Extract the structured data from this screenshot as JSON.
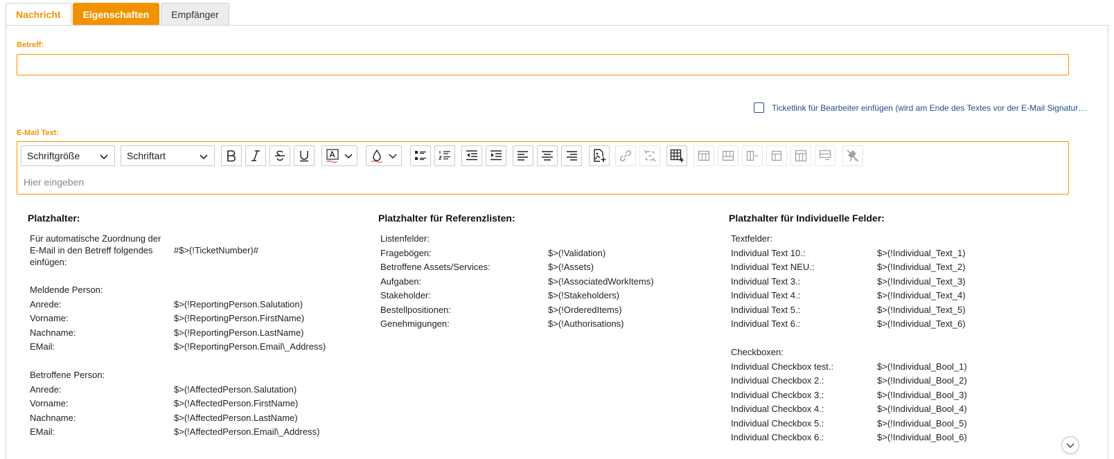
{
  "tabs": [
    {
      "label": "Nachricht"
    },
    {
      "label": "Eigenschaften"
    },
    {
      "label": "Empfänger"
    }
  ],
  "subject": {
    "label": "Betreff:",
    "value": ""
  },
  "ticketlink": {
    "label": "Ticketlink für Bearbeiter einfügen (wird am Ende des Textes vor der E-Mail Signatur eingefügt)",
    "checked": false
  },
  "email_text": {
    "label": "E-Mail Text:",
    "font_size_select": "Schriftgröße",
    "font_family_select": "Schriftart",
    "placeholder": "Hier eingeben"
  },
  "icons": {
    "bold": "bold-icon",
    "italic": "italic-icon",
    "strike": "strikethrough-icon",
    "underline": "underline-icon",
    "font_color": "font-color-icon",
    "highlight": "highlight-color-icon",
    "bullets": "bulleted-list-icon",
    "numbers": "numbered-list-icon",
    "outdent": "outdent-icon",
    "indent": "indent-icon",
    "align_left": "align-left-icon",
    "align_center": "align-center-icon",
    "align_right": "align-right-icon",
    "insert_image": "insert-image-icon",
    "link": "link-icon",
    "unlink": "unlink-icon",
    "table": "insert-table-icon",
    "clear": "clear-format-icon"
  },
  "platzhalter": {
    "title": "Platzhalter:",
    "intro": [
      "Für automatische Zuordnung der",
      "E-Mail in den Betreff folgendes",
      "einfügen:"
    ],
    "intro_value": "#$>(!TicketNumber)#",
    "reporting": {
      "title": "Meldende Person:",
      "rows": [
        {
          "k": "Anrede:",
          "v": "$>(!ReportingPerson.Salutation)"
        },
        {
          "k": "Vorname:",
          "v": "$>(!ReportingPerson.FirstName)"
        },
        {
          "k": "Nachname:",
          "v": "$>(!ReportingPerson.LastName)"
        },
        {
          "k": "EMail:",
          "v": "$>(!ReportingPerson.Email\\_Address)"
        }
      ]
    },
    "affected": {
      "title": "Betroffene Person:",
      "rows": [
        {
          "k": "Anrede:",
          "v": "$>(!AffectedPerson.Salutation)"
        },
        {
          "k": "Vorname:",
          "v": "$>(!AffectedPerson.FirstName)"
        },
        {
          "k": "Nachname:",
          "v": "$>(!AffectedPerson.LastName)"
        },
        {
          "k": "EMail:",
          "v": "$>(!AffectedPerson.Email\\_Address)"
        }
      ]
    }
  },
  "referenz": {
    "title": "Platzhalter für Referenzlisten:",
    "sub": "Listenfelder:",
    "rows": [
      {
        "k": "Fragebögen:",
        "v": "$>(!Validation)"
      },
      {
        "k": "Betroffene Assets/Services:",
        "v": "$>(!Assets)"
      },
      {
        "k": "Aufgaben:",
        "v": "$>(!AssociatedWorkItems)"
      },
      {
        "k": "Stakeholder:",
        "v": "$>(!Stakeholders)"
      },
      {
        "k": "Bestellpositionen:",
        "v": "$>(!OrderedItems)"
      },
      {
        "k": "Genehmigungen:",
        "v": "$>(!Authorisations)"
      }
    ]
  },
  "individuell": {
    "title": "Platzhalter für Individuelle Felder:",
    "text_sub": "Textfelder:",
    "text_rows": [
      {
        "k": "Individual Text 10.:",
        "v": "$>(!Individual_Text_1)"
      },
      {
        "k": "Individual Text NEU.:",
        "v": "$>(!Individual_Text_2)"
      },
      {
        "k": "Individual Text 3.:",
        "v": "$>(!Individual_Text_3)"
      },
      {
        "k": "Individual Text 4.:",
        "v": "$>(!Individual_Text_4)"
      },
      {
        "k": "Individual Text 5.:",
        "v": "$>(!Individual_Text_5)"
      },
      {
        "k": "Individual Text 6.:",
        "v": "$>(!Individual_Text_6)"
      }
    ],
    "bool_sub": "Checkboxen:",
    "bool_rows": [
      {
        "k": "Individual Checkbox test.:",
        "v": "$>(!Individual_Bool_1)"
      },
      {
        "k": "Individual Checkbox 2.:",
        "v": "$>(!Individual_Bool_2)"
      },
      {
        "k": "Individual Checkbox 3.:",
        "v": "$>(!Individual_Bool_3)"
      },
      {
        "k": "Individual Checkbox 4.:",
        "v": "$>(!Individual_Bool_4)"
      },
      {
        "k": "Individual Checkbox 5.:",
        "v": "$>(!Individual_Bool_5)"
      },
      {
        "k": "Individual Checkbox 6.:",
        "v": "$>(!Individual_Bool_6)"
      }
    ]
  },
  "colors": {
    "accent": "#f39200",
    "link": "#1f4e8c"
  }
}
